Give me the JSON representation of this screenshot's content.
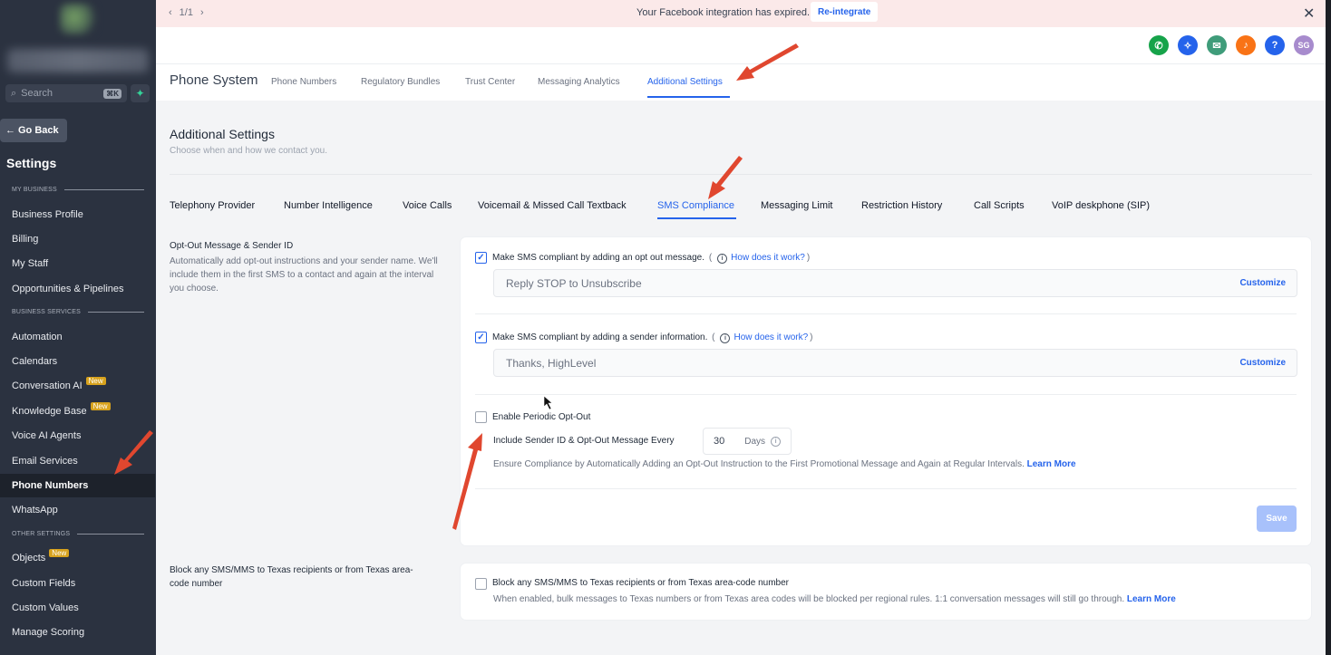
{
  "sidebar": {
    "search_placeholder": "Search",
    "search_shortcut": "⌘K",
    "go_back": "Go Back",
    "title": "Settings",
    "sections": [
      {
        "label": "MY BUSINESS"
      },
      {
        "label": "BUSINESS SERVICES"
      },
      {
        "label": "OTHER SETTINGS"
      }
    ],
    "items": [
      {
        "label": "Business Profile"
      },
      {
        "label": "Billing"
      },
      {
        "label": "My Staff"
      },
      {
        "label": "Opportunities & Pipelines"
      },
      {
        "label": "Automation"
      },
      {
        "label": "Calendars"
      },
      {
        "label": "Conversation AI",
        "badge": "New"
      },
      {
        "label": "Knowledge Base",
        "badge": "New"
      },
      {
        "label": "Voice AI Agents"
      },
      {
        "label": "Email Services"
      },
      {
        "label": "Phone Numbers",
        "active": true
      },
      {
        "label": "WhatsApp"
      },
      {
        "label": "Objects",
        "badge": "New"
      },
      {
        "label": "Custom Fields"
      },
      {
        "label": "Custom Values"
      },
      {
        "label": "Manage Scoring"
      }
    ]
  },
  "banner": {
    "pager": "1/1",
    "message": "Your Facebook integration has expired.",
    "action": "Re-integrate"
  },
  "topbar": {
    "avatar_initials": "SG",
    "help": "?"
  },
  "subnav": {
    "title": "Phone System",
    "tabs": [
      "Phone Numbers",
      "Regulatory Bundles",
      "Trust Center",
      "Messaging Analytics",
      "Additional Settings"
    ],
    "active_tab": "Additional Settings"
  },
  "page": {
    "title": "Additional Settings",
    "subtitle": "Choose when and how we contact you.",
    "tabs": [
      "Telephony Provider",
      "Number Intelligence",
      "Voice Calls",
      "Voicemail & Missed Call Textback",
      "SMS Compliance",
      "Messaging Limit",
      "Restriction History",
      "Call Scripts",
      "VoIP deskphone (SIP)"
    ],
    "active_tab": "SMS Compliance"
  },
  "optout": {
    "label": "Opt-Out Message & Sender ID",
    "description": "Automatically add opt-out instructions and your sender name. We'll include them in the first SMS to a contact and again at the interval you choose.",
    "opt_out_checkbox": {
      "label": "Make SMS compliant by adding an opt out message.",
      "checked": true,
      "link": "How does it work?"
    },
    "opt_out_message": "Reply STOP to Unsubscribe",
    "sender_checkbox": {
      "label": "Make SMS compliant by adding a sender information.",
      "checked": true,
      "link": "How does it work?"
    },
    "sender_message": "Thanks, HighLevel",
    "customize_label": "Customize",
    "periodic": {
      "label": "Enable Periodic Opt-Out",
      "checked": false
    },
    "interval_label": "Include Sender ID & Opt-Out Message Every",
    "interval_value": "30",
    "interval_unit": "Days",
    "compliance_note": "Ensure Compliance by Automatically Adding an Opt-Out Instruction to the First Promotional Message and Again at Regular Intervals.",
    "learn_more": "Learn More",
    "save": "Save"
  },
  "texas": {
    "label": "Block any SMS/MMS to Texas recipients or from Texas area-code number",
    "checkbox_label": "Block any SMS/MMS to Texas recipients or from Texas area-code number",
    "checked": false,
    "note": "When enabled, bulk messages to Texas numbers or from Texas area codes will be blocked per regional rules. 1:1 conversation messages will still go through.",
    "learn_more": "Learn More"
  },
  "colors": {
    "accent": "#2563eb",
    "sidebar_bg": "#2b3240",
    "banner_bg": "#fbe9e9",
    "annotation_arrow": "#e0472f"
  }
}
